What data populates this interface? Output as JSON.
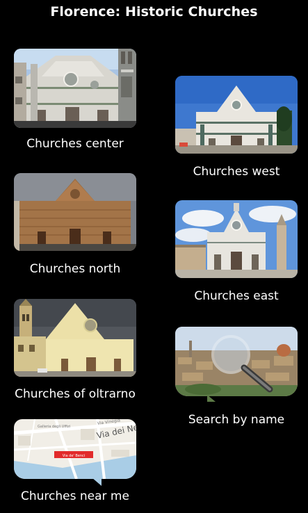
{
  "header": {
    "title": "Florence: Historic Churches"
  },
  "tiles": [
    {
      "label": "Churches center",
      "icon": "duomo-photo"
    },
    {
      "label": "Churches west",
      "icon": "santa-maria-novella-photo"
    },
    {
      "label": "Churches north",
      "icon": "san-lorenzo-photo"
    },
    {
      "label": "Churches east",
      "icon": "santa-croce-photo"
    },
    {
      "label": "Churches of oltrarno",
      "icon": "santo-spirito-photo"
    },
    {
      "label": "Search by name",
      "icon": "magnifier-over-city-photo"
    },
    {
      "label": "Churches near me",
      "icon": "map-photo"
    }
  ],
  "map_text": {
    "street": "Via dei Neri",
    "top_left": "Galleria degli Uffizi",
    "top_mid": "Via Vinegia",
    "marker": "Via de' Benci"
  },
  "colors": {
    "background": "#000000",
    "text": "#ffffff"
  }
}
